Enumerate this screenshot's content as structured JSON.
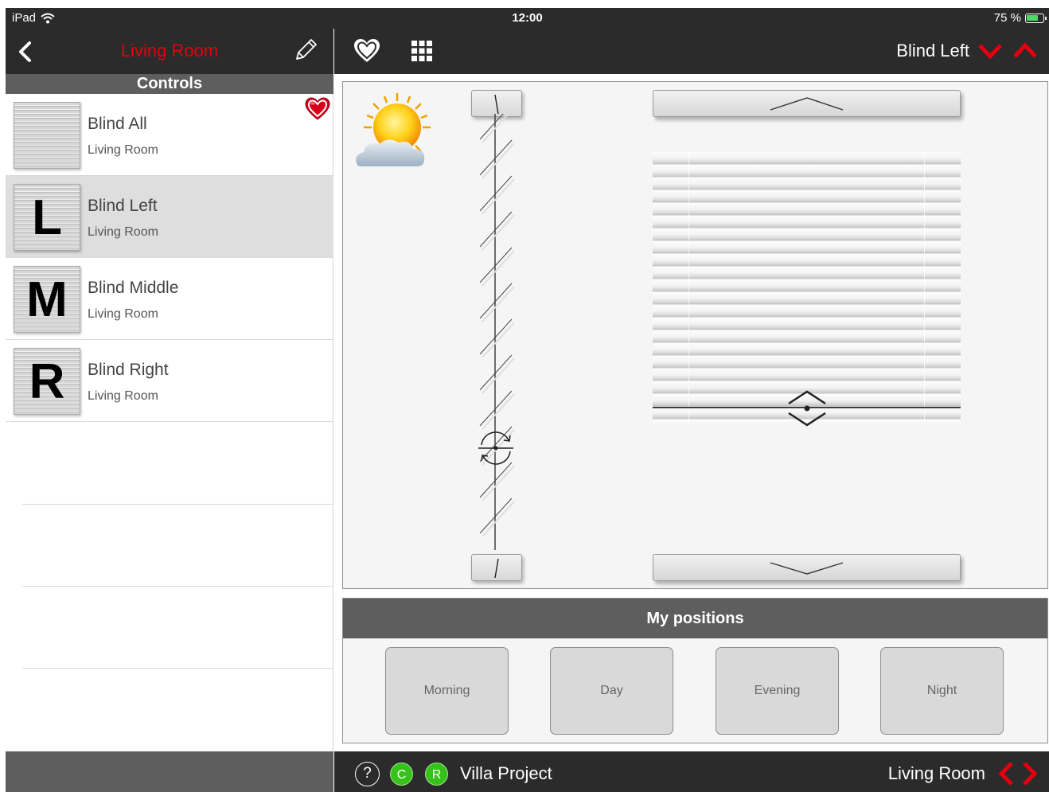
{
  "status_bar": {
    "device": "iPad",
    "time": "12:00",
    "battery_text": "75 %",
    "battery_level": 0.75
  },
  "left_header": {
    "title": "Living Room"
  },
  "controls_header": "Controls",
  "devices": [
    {
      "name": "Blind All",
      "room": "Living Room",
      "letter": "",
      "favorite": true,
      "selected": false
    },
    {
      "name": "Blind Left",
      "room": "Living Room",
      "letter": "L",
      "favorite": false,
      "selected": true
    },
    {
      "name": "Blind Middle",
      "room": "Living Room",
      "letter": "M",
      "favorite": false,
      "selected": false
    },
    {
      "name": "Blind Right",
      "room": "Living Room",
      "letter": "R",
      "favorite": false,
      "selected": false
    }
  ],
  "right_header": {
    "device_title": "Blind Left"
  },
  "positions": {
    "title": "My positions",
    "buttons": [
      "Morning",
      "Day",
      "Evening",
      "Night"
    ]
  },
  "footer": {
    "help": "?",
    "status_c": "C",
    "status_r": "R",
    "project": "Villa Project",
    "room": "Living Room"
  },
  "icons": {
    "status_bar": [
      "wifi-icon",
      "battery-icon"
    ],
    "left_header": [
      "back-chevron-icon",
      "pencil-icon"
    ],
    "right_header": [
      "heart-icon",
      "grid-icon",
      "chevron-down-icon",
      "chevron-up-icon"
    ],
    "panel": [
      "sun-cloud-icon",
      "rotate-icon",
      "position-handle-icon"
    ],
    "footer": [
      "chevron-left-icon",
      "chevron-right-icon"
    ]
  },
  "colors": {
    "accent": "#e3000f",
    "status_green": "#36c21a",
    "bar_dark": "#2b2b2b",
    "bar_gray": "#5e5e5e"
  }
}
